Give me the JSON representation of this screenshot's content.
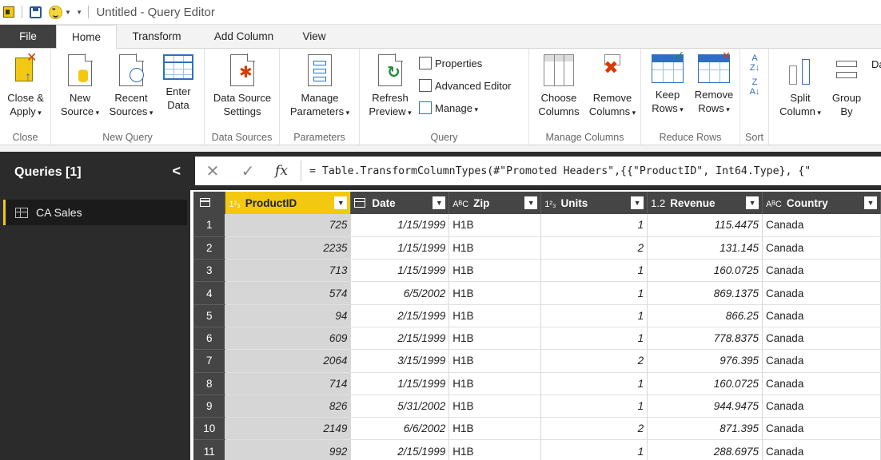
{
  "window": {
    "title": "Untitled - Query Editor"
  },
  "tabs": [
    "File",
    "Home",
    "Transform",
    "Add Column",
    "View"
  ],
  "ribbon": {
    "groups": {
      "close": "Close",
      "new_query": "New Query",
      "data_sources": "Data Sources",
      "parameters": "Parameters",
      "query": "Query",
      "manage_columns": "Manage Columns",
      "reduce_rows": "Reduce Rows",
      "sort": "Sort"
    },
    "buttons": {
      "close_apply": [
        "Close &",
        "Apply"
      ],
      "new_source": [
        "New",
        "Source"
      ],
      "recent_sources": [
        "Recent",
        "Sources"
      ],
      "enter_data": [
        "Enter",
        "Data"
      ],
      "data_source_settings": [
        "Data Source",
        "Settings"
      ],
      "manage_parameters": [
        "Manage",
        "Parameters"
      ],
      "refresh_preview": [
        "Refresh",
        "Preview"
      ],
      "properties": "Properties",
      "advanced_editor": "Advanced Editor",
      "manage": "Manage",
      "choose_columns": [
        "Choose",
        "Columns"
      ],
      "remove_columns": [
        "Remove",
        "Columns"
      ],
      "keep_rows": [
        "Keep",
        "Rows"
      ],
      "remove_rows": [
        "Remove",
        "Rows"
      ],
      "split_column": [
        "Split",
        "Column"
      ],
      "group_by": [
        "Group",
        "By"
      ],
      "cut_off_label": "Da"
    }
  },
  "queries": {
    "header": "Queries [1]",
    "collapse": "<",
    "items": [
      {
        "label": "CA Sales"
      }
    ]
  },
  "formula_bar": {
    "cancel": "✕",
    "confirm": "✓",
    "fx": "fx",
    "formula": "= Table.TransformColumnTypes(#\"Promoted Headers\",{{\"ProductID\", Int64.Type}, {\""
  },
  "grid": {
    "columns": [
      {
        "name": "ProductID",
        "type_icon": "1²₃",
        "align": "num"
      },
      {
        "name": "Date",
        "type_icon": "calendar",
        "align": "num"
      },
      {
        "name": "Zip",
        "type_icon": "AᴮC",
        "align": "txt"
      },
      {
        "name": "Units",
        "type_icon": "1²₃",
        "align": "num"
      },
      {
        "name": "Revenue",
        "type_icon": "1.2",
        "align": "num"
      },
      {
        "name": "Country",
        "type_icon": "AᴮC",
        "align": "txt"
      }
    ],
    "rows": [
      [
        "725",
        "1/15/1999",
        "H1B",
        "1",
        "115.4475",
        "Canada"
      ],
      [
        "2235",
        "1/15/1999",
        "H1B",
        "2",
        "131.145",
        "Canada"
      ],
      [
        "713",
        "1/15/1999",
        "H1B",
        "1",
        "160.0725",
        "Canada"
      ],
      [
        "574",
        "6/5/2002",
        "H1B",
        "1",
        "869.1375",
        "Canada"
      ],
      [
        "94",
        "2/15/1999",
        "H1B",
        "1",
        "866.25",
        "Canada"
      ],
      [
        "609",
        "2/15/1999",
        "H1B",
        "1",
        "778.8375",
        "Canada"
      ],
      [
        "2064",
        "3/15/1999",
        "H1B",
        "2",
        "976.395",
        "Canada"
      ],
      [
        "714",
        "1/15/1999",
        "H1B",
        "1",
        "160.0725",
        "Canada"
      ],
      [
        "826",
        "5/31/2002",
        "H1B",
        "1",
        "944.9475",
        "Canada"
      ],
      [
        "2149",
        "6/6/2002",
        "H1B",
        "2",
        "871.395",
        "Canada"
      ],
      [
        "992",
        "2/15/1999",
        "H1B",
        "1",
        "288.6975",
        "Canada"
      ]
    ]
  },
  "colors": {
    "accent": "#f2c811",
    "dark_pane": "#2b2b2b",
    "header": "#454545"
  }
}
